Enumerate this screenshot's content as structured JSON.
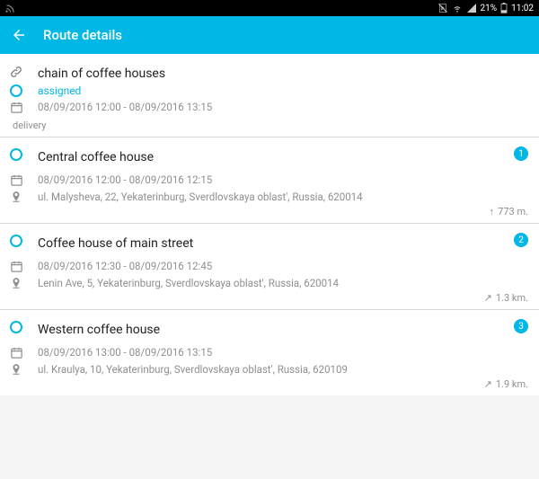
{
  "status": {
    "battery": "21%",
    "time": "11:02"
  },
  "header": {
    "title": "Route details"
  },
  "summary": {
    "title": "chain of coffee houses",
    "status": "assigned",
    "window": "08/09/2016 12:00 - 08/09/2016 13:15",
    "type": "delivery"
  },
  "stops": [
    {
      "title": "Central coffee house",
      "window": "08/09/2016 12:00 - 08/09/2016 12:15",
      "address": "ul. Malysheva, 22, Yekaterinburg, Sverdlovskaya oblast', Russia, 620014",
      "badge": "1",
      "distance": "773 m."
    },
    {
      "title": "Coffee house of main street",
      "window": "08/09/2016 12:30 - 08/09/2016 12:45",
      "address": "Lenin Ave, 5, Yekaterinburg, Sverdlovskaya oblast', Russia, 620014",
      "badge": "2",
      "distance": "1.3 km."
    },
    {
      "title": "Western coffee house",
      "window": "08/09/2016 13:00 - 08/09/2016 13:15",
      "address": "ul. Kraulya, 10, Yekaterinburg, Sverdlovskaya oblast', Russia, 620109",
      "badge": "3",
      "distance": "1.9 km."
    }
  ]
}
